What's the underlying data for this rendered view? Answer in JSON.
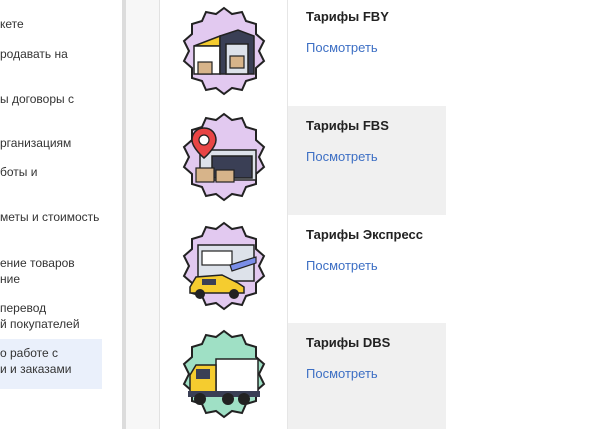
{
  "sidebar": {
    "items": [
      {
        "label": "кете"
      },
      {
        "label": "родавать на"
      },
      {
        "label": "ы договоры с"
      },
      {
        "label": "рганизациям"
      },
      {
        "label": "боты и"
      },
      {
        "label": "меты и стоимость"
      },
      {
        "label": "ение товаров\nние"
      },
      {
        "label": "перевод\nй покупателей"
      },
      {
        "label": "о работе с\nи и заказами"
      }
    ]
  },
  "tariffs": [
    {
      "title": "Тарифы FBY",
      "link": "Посмотреть",
      "icon": "warehouse-icon"
    },
    {
      "title": "Тарифы FBS",
      "link": "Посмотреть",
      "icon": "pickup-point-icon"
    },
    {
      "title": "Тарифы Экспресс",
      "link": "Посмотреть",
      "icon": "taxi-delivery-icon"
    },
    {
      "title": "Тарифы DBS",
      "link": "Посмотреть",
      "icon": "truck-icon"
    }
  ],
  "colors": {
    "link": "#3d6fc4",
    "badge_purple": "#e2c9f0",
    "badge_green": "#9fe0c5",
    "accent_yellow": "#f5cc2f"
  }
}
